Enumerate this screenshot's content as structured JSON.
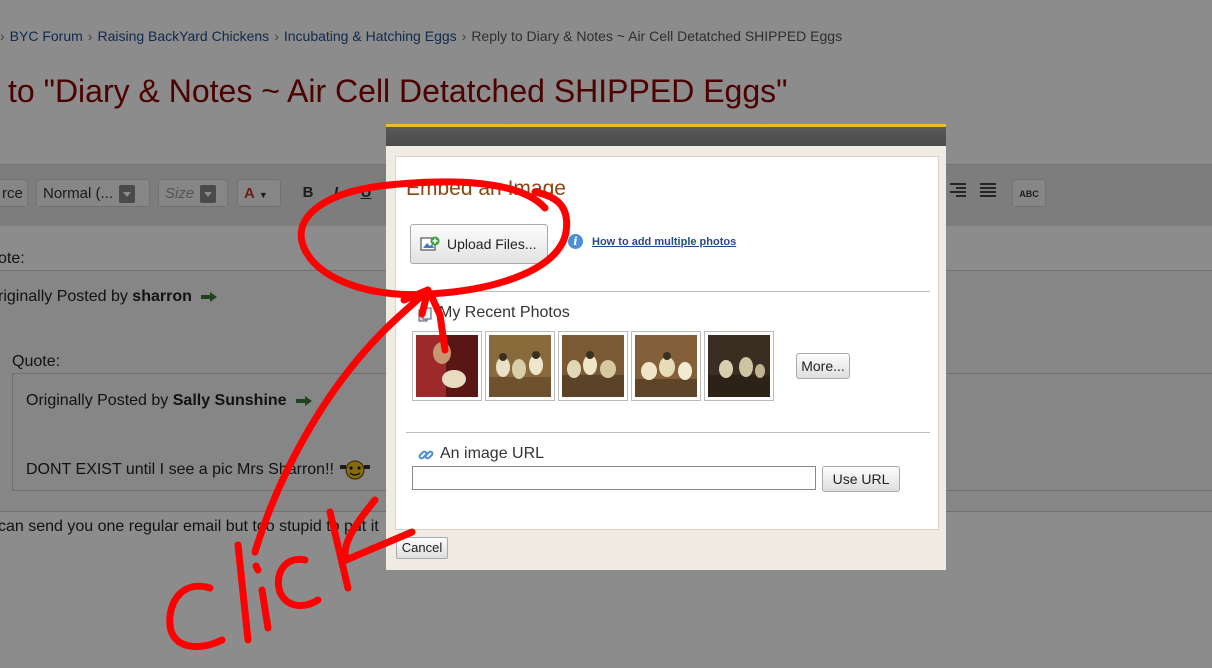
{
  "breadcrumb": {
    "items": [
      "BYC Forum",
      "Raising BackYard Chickens",
      "Incubating & Hatching Eggs"
    ],
    "current": "Reply to Diary & Notes ~ Air Cell Detatched SHIPPED Eggs",
    "separator": "›"
  },
  "page_title": "to \"Diary & Notes ~ Air Cell Detatched SHIPPED Eggs\"",
  "toolbar": {
    "source_label": "rce",
    "format_label": "Normal (...",
    "size_label": "Size",
    "font_color_label": "A",
    "bold_label": "B",
    "italic_label": "I",
    "underline_label": "U",
    "spellcheck_label": "ABC"
  },
  "post": {
    "quote_label": "ote:",
    "originally_posted_by": "riginally Posted by",
    "author": "sharron",
    "nested_quote_label": "Quote:",
    "nested_originally_posted_by": "Originally Posted by",
    "nested_author": "Sally Sunshine",
    "nested_text": "DONT EXIST until I see a pic Mrs Sharron!!",
    "reply_text": "can send you one regular email but too stupid to put it"
  },
  "modal": {
    "title": "Embed an Image",
    "upload_button": "Upload Files...",
    "help_link": "How to add multiple photos",
    "recent_title": "My Recent Photos",
    "more_button": "More...",
    "url_title": "An image URL",
    "url_value": "",
    "use_url_button": "Use URL",
    "cancel_button": "Cancel"
  },
  "annotation": {
    "text": "Click",
    "color": "#ff0000"
  },
  "colors": {
    "title": "#8b0000",
    "link": "#1e4d8c",
    "modal_accent": "#f4b92a",
    "modal_title": "#8b4513"
  }
}
